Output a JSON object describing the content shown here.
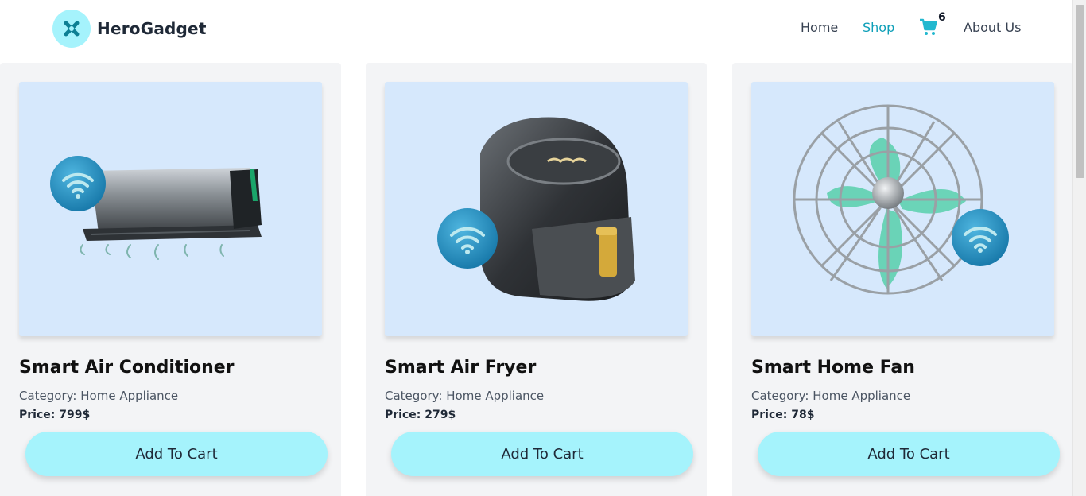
{
  "brand": {
    "name": "HeroGadget",
    "logo_icon": "x-icon"
  },
  "nav": {
    "home": "Home",
    "shop": "Shop",
    "cart_count": "6",
    "about": "About Us",
    "active": "Shop"
  },
  "products": [
    {
      "title": "Smart Air Conditioner",
      "category": "Category: Home Appliance",
      "price": "Price: 799$",
      "button": "Add To Cart"
    },
    {
      "title": "Smart Air Fryer",
      "category": "Category: Home Appliance",
      "price": "Price: 279$",
      "button": "Add To Cart"
    },
    {
      "title": "Smart Home Fan",
      "category": "Category: Home Appliance",
      "price": "Price: 78$",
      "button": "Add To Cart"
    }
  ],
  "colors": {
    "accent": "#a5f3fc",
    "active_link": "#0e9fb8",
    "card_bg": "#f3f4f6",
    "image_bg": "#d6e8fc"
  }
}
